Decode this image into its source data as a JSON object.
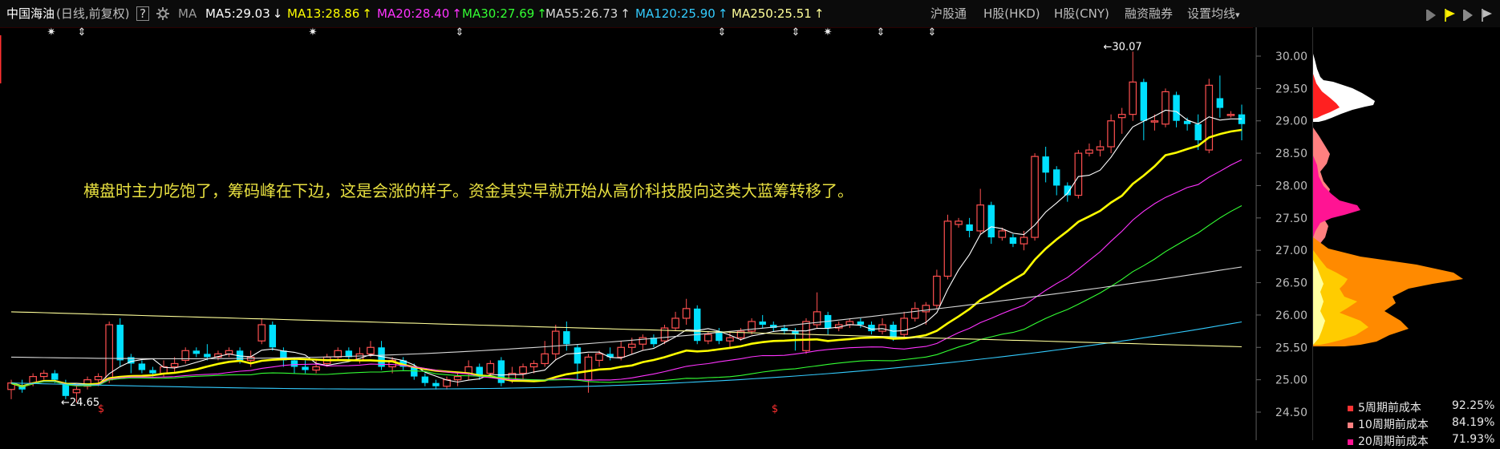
{
  "header": {
    "stock_name": "中国海油",
    "period_info": "(日线,前复权)",
    "help_label": "?",
    "gear_icon": "gear-icon",
    "ma_label": "MA",
    "ma_items": [
      {
        "label": "MA5:29.03",
        "arrow": "↓",
        "color": "#ffffff"
      },
      {
        "label": "MA13:28.86",
        "arrow": "↑",
        "color": "#ffff00"
      },
      {
        "label": "MA20:28.40",
        "arrow": "↑",
        "color": "#ff33ff"
      },
      {
        "label": "MA30:27.69",
        "arrow": "↑",
        "color": "#33ff33"
      },
      {
        "label": "MA55:26.73",
        "arrow": "↑",
        "color": "#d8d8d8"
      },
      {
        "label": "MA120:25.90",
        "arrow": "↑",
        "color": "#33ccff"
      },
      {
        "label": "MA250:25.51",
        "arrow": "↑",
        "color": "#ffff99"
      }
    ],
    "tabs": [
      "沪股通",
      "H股(HKD)",
      "H股(CNY)",
      "融资融券"
    ],
    "settings_label": "设置均线",
    "settings_arrow": "▾"
  },
  "toolbar_icons": [
    "arrow-icon",
    "flag-icon",
    "arrow-icon",
    "flag-icon"
  ],
  "annotation": "横盘时主力吃饱了，筹码峰在下边，这是会涨的样子。资金其实早就开始从高价科技股向这类大蓝筹转移了。",
  "price_labels": {
    "high": "←30.07",
    "low": "←24.65"
  },
  "event_marks": [
    "✷",
    "⇕",
    "✷",
    "⇕",
    "⇕",
    "⇕",
    "✷",
    "⇕",
    "⇕"
  ],
  "dividend_marks": [
    "$",
    "$"
  ],
  "legend": [
    {
      "label": "5周期前成本",
      "pct": "92.25%",
      "color": "#ff3333"
    },
    {
      "label": "10周期前成本",
      "pct": "84.19%",
      "color": "#ff8080"
    },
    {
      "label": "20周期前成本",
      "pct": "71.93%",
      "color": "#ff1493"
    }
  ],
  "colors": {
    "up": "#ff5050",
    "down": "#00e0ff",
    "bg": "#000000"
  },
  "chart_data": {
    "type": "candlestick",
    "y_ticks": [
      "30.00",
      "29.50",
      "29.00",
      "28.50",
      "28.00",
      "27.50",
      "27.00",
      "26.50",
      "26.00",
      "25.50",
      "25.00",
      "24.50"
    ],
    "ylim": [
      24.4,
      30.4
    ],
    "candles": [
      [
        24.85,
        24.95,
        24.7,
        25.0
      ],
      [
        24.9,
        24.85,
        24.8,
        25.0
      ],
      [
        24.95,
        25.05,
        24.9,
        25.1
      ],
      [
        25.05,
        25.1,
        25.0,
        25.15
      ],
      [
        25.1,
        25.0,
        24.95,
        25.15
      ],
      [
        24.95,
        24.75,
        24.7,
        25.0
      ],
      [
        24.8,
        24.85,
        24.65,
        24.9
      ],
      [
        24.9,
        25.0,
        24.85,
        25.05
      ],
      [
        25.0,
        25.05,
        24.9,
        25.1
      ],
      [
        25.0,
        25.85,
        24.95,
        25.9
      ],
      [
        25.85,
        25.3,
        25.2,
        25.95
      ],
      [
        25.35,
        25.25,
        25.1,
        25.4
      ],
      [
        25.25,
        25.15,
        25.1,
        25.3
      ],
      [
        25.15,
        25.1,
        25.05,
        25.2
      ],
      [
        25.1,
        25.2,
        25.05,
        25.3
      ],
      [
        25.2,
        25.25,
        25.1,
        25.35
      ],
      [
        25.3,
        25.45,
        25.25,
        25.5
      ],
      [
        25.45,
        25.4,
        25.35,
        25.5
      ],
      [
        25.4,
        25.35,
        25.3,
        25.55
      ],
      [
        25.35,
        25.4,
        25.3,
        25.45
      ],
      [
        25.4,
        25.45,
        25.35,
        25.5
      ],
      [
        25.45,
        25.3,
        25.25,
        25.5
      ],
      [
        25.3,
        25.35,
        25.2,
        25.45
      ],
      [
        25.6,
        25.85,
        25.55,
        25.95
      ],
      [
        25.85,
        25.5,
        25.45,
        25.9
      ],
      [
        25.45,
        25.3,
        25.2,
        25.5
      ],
      [
        25.3,
        25.2,
        25.1,
        25.35
      ],
      [
        25.2,
        25.15,
        25.1,
        25.3
      ],
      [
        25.15,
        25.2,
        25.1,
        25.3
      ],
      [
        25.25,
        25.35,
        25.2,
        25.4
      ],
      [
        25.35,
        25.45,
        25.3,
        25.5
      ],
      [
        25.45,
        25.35,
        25.3,
        25.5
      ],
      [
        25.3,
        25.4,
        25.25,
        25.5
      ],
      [
        25.4,
        25.5,
        25.35,
        25.6
      ],
      [
        25.5,
        25.2,
        25.15,
        25.6
      ],
      [
        25.2,
        25.3,
        25.1,
        25.35
      ],
      [
        25.3,
        25.2,
        25.15,
        25.35
      ],
      [
        25.2,
        25.05,
        25.0,
        25.25
      ],
      [
        25.05,
        24.95,
        24.9,
        25.1
      ],
      [
        24.95,
        24.9,
        24.85,
        25.0
      ],
      [
        24.9,
        25.0,
        24.85,
        25.05
      ],
      [
        25.0,
        25.05,
        24.9,
        25.1
      ],
      [
        25.1,
        25.2,
        25.0,
        25.3
      ],
      [
        25.2,
        25.05,
        25.0,
        25.25
      ],
      [
        25.1,
        25.25,
        25.05,
        25.3
      ],
      [
        25.3,
        24.95,
        24.9,
        25.35
      ],
      [
        25.0,
        25.1,
        24.95,
        25.2
      ],
      [
        25.1,
        25.2,
        25.0,
        25.25
      ],
      [
        25.2,
        25.25,
        25.1,
        25.3
      ],
      [
        25.25,
        25.4,
        25.2,
        25.6
      ],
      [
        25.4,
        25.75,
        25.3,
        25.85
      ],
      [
        25.75,
        25.55,
        25.45,
        25.9
      ],
      [
        25.5,
        25.25,
        25.0,
        25.55
      ],
      [
        25.0,
        25.35,
        24.8,
        25.4
      ],
      [
        25.3,
        25.4,
        25.2,
        25.45
      ],
      [
        25.4,
        25.35,
        25.3,
        25.5
      ],
      [
        25.35,
        25.5,
        25.3,
        25.6
      ],
      [
        25.5,
        25.55,
        25.4,
        25.65
      ],
      [
        25.55,
        25.65,
        25.45,
        25.7
      ],
      [
        25.65,
        25.55,
        25.5,
        25.7
      ],
      [
        25.6,
        25.8,
        25.55,
        25.85
      ],
      [
        25.8,
        25.95,
        25.75,
        26.05
      ],
      [
        25.95,
        26.1,
        25.85,
        26.25
      ],
      [
        26.1,
        25.6,
        25.55,
        26.15
      ],
      [
        25.6,
        25.7,
        25.55,
        25.75
      ],
      [
        25.75,
        25.6,
        25.55,
        25.8
      ],
      [
        25.6,
        25.65,
        25.5,
        25.75
      ],
      [
        25.65,
        25.75,
        25.6,
        25.8
      ],
      [
        25.75,
        25.9,
        25.7,
        25.95
      ],
      [
        25.9,
        25.85,
        25.8,
        26.0
      ],
      [
        25.85,
        25.8,
        25.75,
        25.9
      ],
      [
        25.8,
        25.75,
        25.7,
        25.85
      ],
      [
        25.75,
        25.7,
        25.45,
        25.8
      ],
      [
        25.45,
        25.9,
        25.4,
        25.95
      ],
      [
        25.85,
        26.05,
        25.8,
        26.35
      ],
      [
        26.0,
        25.8,
        25.7,
        26.05
      ],
      [
        25.8,
        25.85,
        25.75,
        25.9
      ],
      [
        25.85,
        25.9,
        25.8,
        25.95
      ],
      [
        25.9,
        25.85,
        25.8,
        25.95
      ],
      [
        25.85,
        25.75,
        25.7,
        25.9
      ],
      [
        25.75,
        25.85,
        25.7,
        25.95
      ],
      [
        25.85,
        25.65,
        25.6,
        25.9
      ],
      [
        25.7,
        25.95,
        25.65,
        26.05
      ],
      [
        25.95,
        26.1,
        25.9,
        26.2
      ],
      [
        26.05,
        26.15,
        25.85,
        26.2
      ],
      [
        26.15,
        26.6,
        26.1,
        26.7
      ],
      [
        26.6,
        27.45,
        26.55,
        27.55
      ],
      [
        27.4,
        27.45,
        27.35,
        27.5
      ],
      [
        27.4,
        27.3,
        27.2,
        27.5
      ],
      [
        27.3,
        27.7,
        27.25,
        27.95
      ],
      [
        27.7,
        27.2,
        27.1,
        27.75
      ],
      [
        27.2,
        27.3,
        27.15,
        27.35
      ],
      [
        27.2,
        27.1,
        27.05,
        27.25
      ],
      [
        27.1,
        27.2,
        27.0,
        27.3
      ],
      [
        27.2,
        28.45,
        27.15,
        28.5
      ],
      [
        28.45,
        28.2,
        28.05,
        28.6
      ],
      [
        28.25,
        28.0,
        27.85,
        28.3
      ],
      [
        28.0,
        27.85,
        27.75,
        28.05
      ],
      [
        27.85,
        28.5,
        27.8,
        28.55
      ],
      [
        28.5,
        28.55,
        28.45,
        28.65
      ],
      [
        28.55,
        28.6,
        28.45,
        28.7
      ],
      [
        28.6,
        29.0,
        28.5,
        29.1
      ],
      [
        29.05,
        29.1,
        28.8,
        29.2
      ],
      [
        29.1,
        29.6,
        29.0,
        30.07
      ],
      [
        29.6,
        29.0,
        28.7,
        29.65
      ],
      [
        29.0,
        29.0,
        28.85,
        29.1
      ],
      [
        28.95,
        29.45,
        28.9,
        29.5
      ],
      [
        29.4,
        29.0,
        28.9,
        29.45
      ],
      [
        29.0,
        28.95,
        28.85,
        29.05
      ],
      [
        28.95,
        28.7,
        28.55,
        29.1
      ],
      [
        28.55,
        29.55,
        28.5,
        29.65
      ],
      [
        29.35,
        29.2,
        29.05,
        29.7
      ],
      [
        29.1,
        29.1,
        29.05,
        29.15
      ],
      [
        29.1,
        28.95,
        28.7,
        29.25
      ]
    ],
    "ma_series": [
      {
        "period": 5,
        "color": "#ffffff"
      },
      {
        "period": 13,
        "color": "#ffff00"
      },
      {
        "period": 20,
        "color": "#ff33ff"
      },
      {
        "period": 30,
        "color": "#33ff33"
      },
      {
        "period": 55,
        "color": "#d8d8d8"
      },
      {
        "period": 120,
        "color": "#33ccff"
      },
      {
        "period": 250,
        "color": "#ffff99"
      }
    ]
  }
}
